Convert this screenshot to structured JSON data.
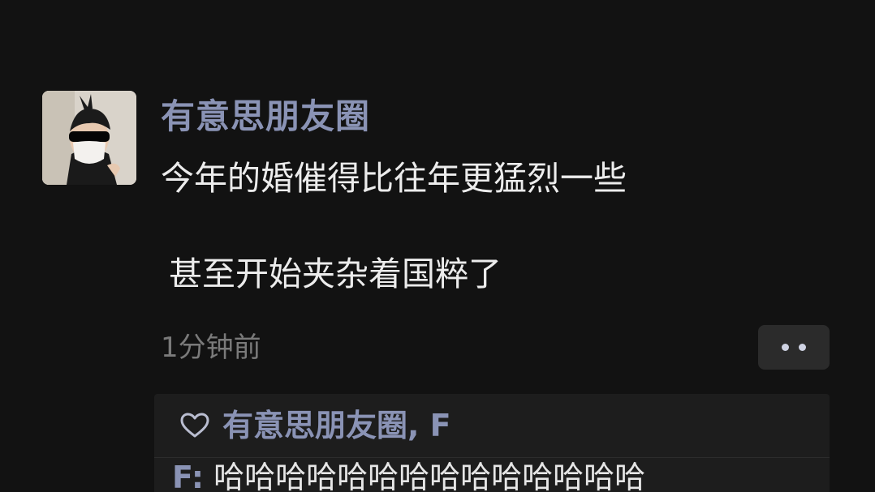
{
  "post": {
    "nickname": "有意思朋友圈",
    "text_line1": "今年的婚催得比往年更猛烈一些",
    "text_line2": "甚至开始夹杂着国粹了",
    "timestamp": "1分钟前"
  },
  "more_button": {
    "icon": "more-dots-icon"
  },
  "interactions": {
    "like_icon": "heart-outline-icon",
    "liked_by": "有意思朋友圈, F",
    "comments": [
      {
        "author": "F:",
        "text": " 哈哈哈哈哈哈哈哈哈哈哈哈哈哈"
      }
    ]
  },
  "colors": {
    "background": "#121212",
    "name_color": "#8a93b5",
    "text_color": "#ececec",
    "timestamp_color": "#7a7a7a",
    "panel_bg": "#1d1d1d"
  }
}
